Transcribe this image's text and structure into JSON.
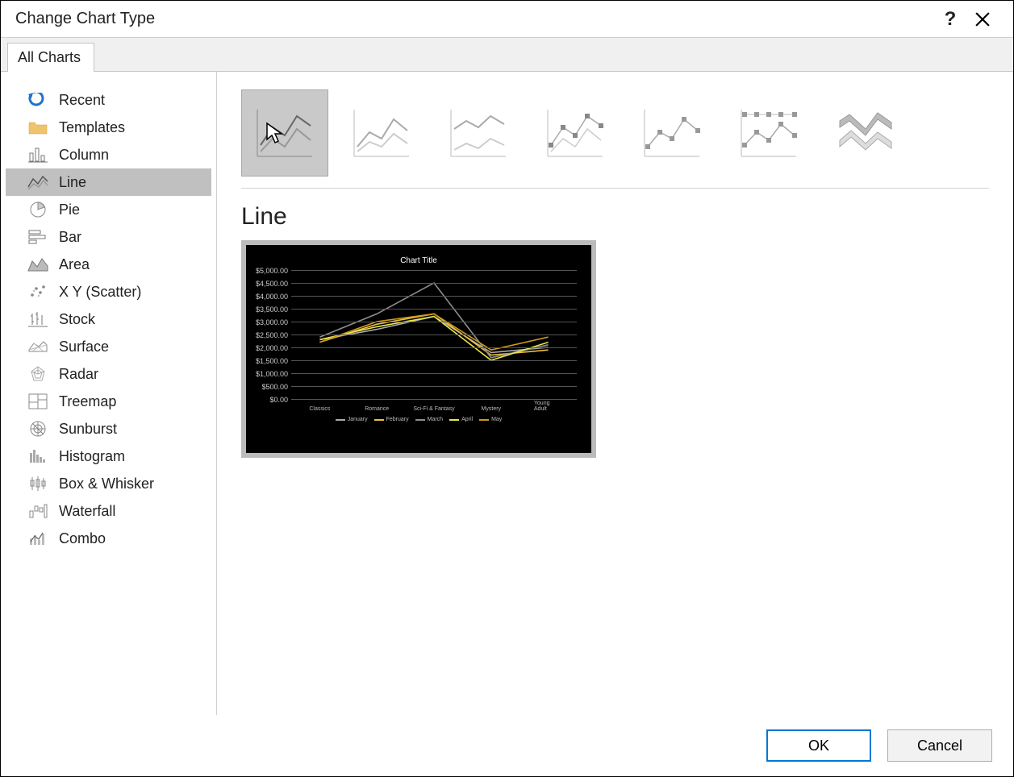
{
  "dialog": {
    "title": "Change Chart Type",
    "tab_label": "All Charts"
  },
  "sidebar": {
    "items": [
      {
        "id": "recent",
        "label": "Recent"
      },
      {
        "id": "templates",
        "label": "Templates"
      },
      {
        "id": "column",
        "label": "Column"
      },
      {
        "id": "line",
        "label": "Line",
        "selected": true
      },
      {
        "id": "pie",
        "label": "Pie"
      },
      {
        "id": "bar",
        "label": "Bar"
      },
      {
        "id": "area",
        "label": "Area"
      },
      {
        "id": "scatter",
        "label": "X Y (Scatter)"
      },
      {
        "id": "stock",
        "label": "Stock"
      },
      {
        "id": "surface",
        "label": "Surface"
      },
      {
        "id": "radar",
        "label": "Radar"
      },
      {
        "id": "treemap",
        "label": "Treemap"
      },
      {
        "id": "sunburst",
        "label": "Sunburst"
      },
      {
        "id": "histogram",
        "label": "Histogram"
      },
      {
        "id": "boxwhisker",
        "label": "Box & Whisker"
      },
      {
        "id": "waterfall",
        "label": "Waterfall"
      },
      {
        "id": "combo",
        "label": "Combo"
      }
    ]
  },
  "content": {
    "subtype_heading": "Line",
    "subtypes": [
      {
        "id": "line",
        "selected": true
      },
      {
        "id": "stacked-line"
      },
      {
        "id": "100-stacked-line"
      },
      {
        "id": "line-markers"
      },
      {
        "id": "stacked-line-markers"
      },
      {
        "id": "100-stacked-line-markers"
      },
      {
        "id": "3d-line"
      }
    ]
  },
  "footer": {
    "ok_label": "OK",
    "cancel_label": "Cancel"
  },
  "chart_data": {
    "type": "line",
    "title": "Chart Title",
    "categories": [
      "Classics",
      "Romance",
      "Sci-Fi & Fantasy",
      "Mystery",
      "Young Adult"
    ],
    "series": [
      {
        "name": "January",
        "color": "#a9a9b0",
        "values": [
          2300,
          2700,
          3200,
          1800,
          2000
        ]
      },
      {
        "name": "February",
        "color": "#efbf3e",
        "values": [
          2200,
          2900,
          3300,
          1700,
          1900
        ]
      },
      {
        "name": "March",
        "color": "#8e8e8e",
        "values": [
          2400,
          3300,
          4500,
          1600,
          2100
        ]
      },
      {
        "name": "April",
        "color": "#e8e84a",
        "values": [
          2300,
          2800,
          3200,
          1500,
          2200
        ]
      },
      {
        "name": "May",
        "color": "#cc9a1c",
        "values": [
          2200,
          3000,
          3300,
          1900,
          2400
        ]
      }
    ],
    "ylabels": [
      "$5,000.00",
      "$4,500.00",
      "$4,000.00",
      "$3,500.00",
      "$3,000.00",
      "$2,500.00",
      "$2,000.00",
      "$1,500.00",
      "$1,000.00",
      "$500.00",
      "$0.00"
    ],
    "ymin": 0,
    "ymax": 5000
  }
}
